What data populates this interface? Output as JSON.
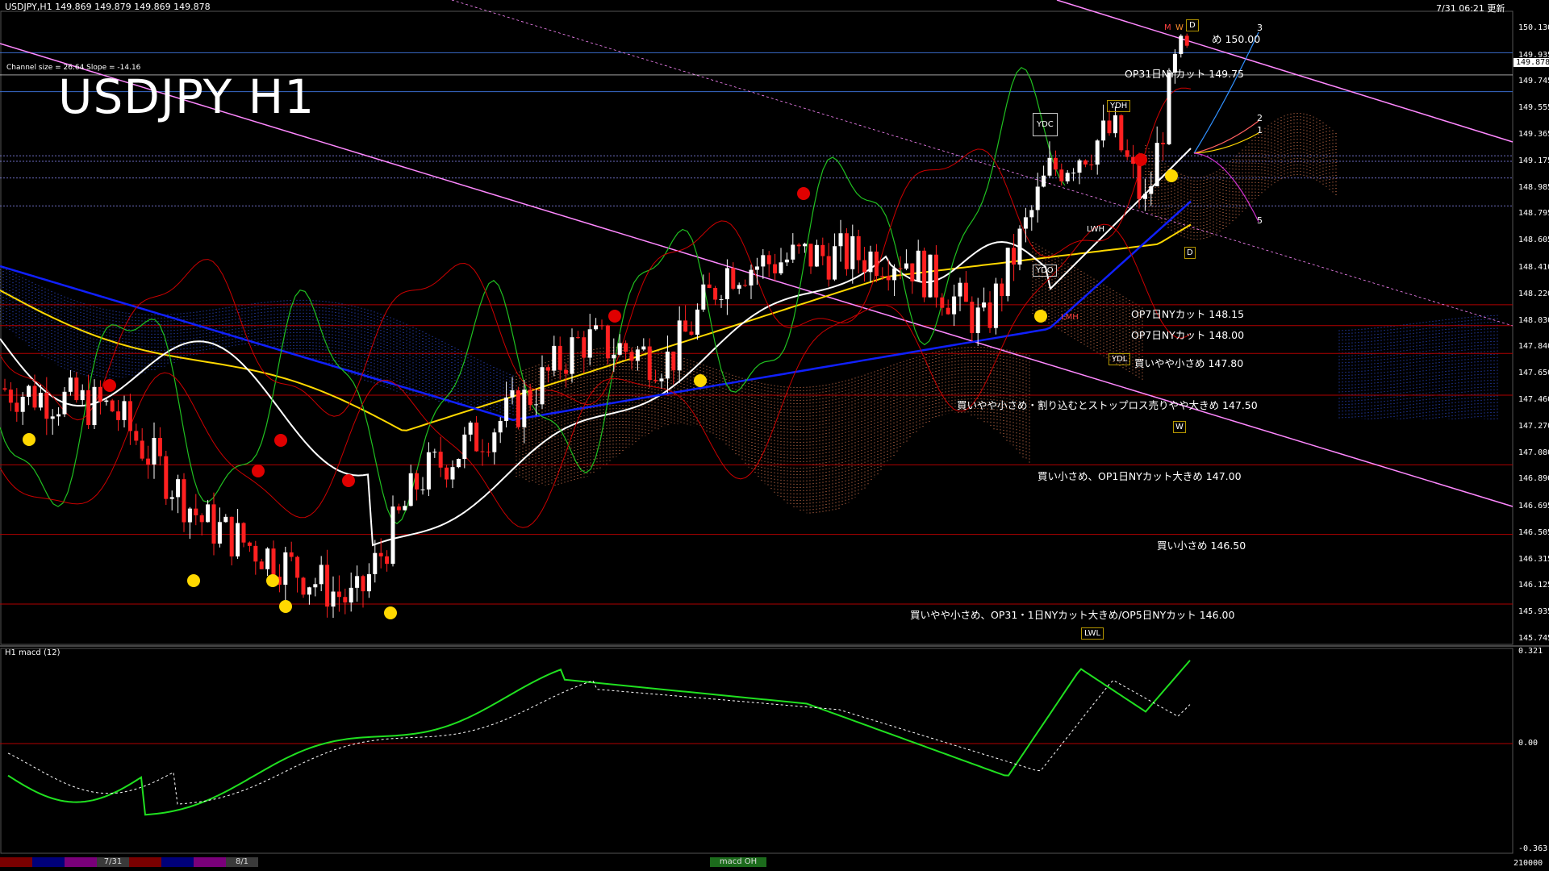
{
  "header": {
    "left": "USDJPY,H1  149.869 149.879 149.869 149.878",
    "right": "7/31 06:21 更新",
    "channel_info": "Channel size = 26.64 Slope = -14.16",
    "title": "USDJPY H1",
    "subwindow_label": "H1  macd (12)"
  },
  "current_price": "149.878",
  "price_axis": [
    "150.130",
    "149.935",
    "149.745",
    "149.555",
    "149.365",
    "149.175",
    "148.985",
    "148.795",
    "148.605",
    "148.410",
    "148.220",
    "148.030",
    "147.840",
    "147.650",
    "147.460",
    "147.270",
    "147.080",
    "146.890",
    "146.695",
    "146.505",
    "146.315",
    "146.125",
    "145.935",
    "145.745"
  ],
  "macd_axis": [
    "0.321",
    "0.00",
    "-0.363",
    "210000"
  ],
  "notes": [
    {
      "text": "め 150.00",
      "id": "n150"
    },
    {
      "text": "OP31日NYカット 149.75",
      "id": "n14975"
    },
    {
      "text": "OP7日NYカット 148.15",
      "id": "n14815"
    },
    {
      "text": "OP7日NYカット 148.00",
      "id": "n14800"
    },
    {
      "text": "買いやや小さめ 147.80",
      "id": "n14780"
    },
    {
      "text": "買いやや小さめ・割り込むとストップロス売りやや大きめ 147.50",
      "id": "n14750"
    },
    {
      "text": "買い小さめ、OP1日NYカット大きめ 147.00",
      "id": "n14700"
    },
    {
      "text": "買い小さめ 146.50",
      "id": "n14650"
    },
    {
      "text": "買いやや小さめ、OP31・1日NYカット大きめ/OP5日NYカット 146.00",
      "id": "n14600"
    }
  ],
  "tags": {
    "ydc": "YDC",
    "ydh": "YDH",
    "ydo": "YDO",
    "ydl": "YDL",
    "lwh": "LWH",
    "lwl": "LWL",
    "lmh": "LMH",
    "m": "M",
    "w": "W",
    "d": "D",
    "d2": "D",
    "w2": "W"
  },
  "fib_labels": [
    "3",
    "2",
    "1",
    "5"
  ],
  "tabs": [
    {
      "color": "#7a0000",
      "label": ""
    },
    {
      "color": "#00007a",
      "label": ""
    },
    {
      "color": "#7a007a",
      "label": ""
    },
    {
      "color": "#3a3a3a",
      "label": "7/31"
    },
    {
      "color": "#7a0000",
      "label": ""
    },
    {
      "color": "#00007a",
      "label": ""
    },
    {
      "color": "#7a007a",
      "label": ""
    },
    {
      "color": "#3a3a3a",
      "label": "8/1"
    },
    {
      "color": "#1c6b1c",
      "label": "macd OH"
    }
  ],
  "colors": {
    "bull": "#ffffff",
    "bear": "#ff2020",
    "tenkan": "#ffffff",
    "kijun": "#ffd800",
    "ma": "#1020ff",
    "chikou": "#20c020",
    "pink": "#ff88ff",
    "red": "#cc0000",
    "kumo_up": "#ff9060",
    "kumo_dn": "#3a5cff"
  },
  "chart_data": {
    "type": "candlestick",
    "symbol": "USDJPY",
    "timeframe": "H1",
    "ylim": [
      145.745,
      150.13
    ],
    "price_levels": [
      150.0,
      149.75,
      148.15,
      148.0,
      147.8,
      147.5,
      147.0,
      146.5,
      146.0
    ],
    "last": 149.878
  }
}
